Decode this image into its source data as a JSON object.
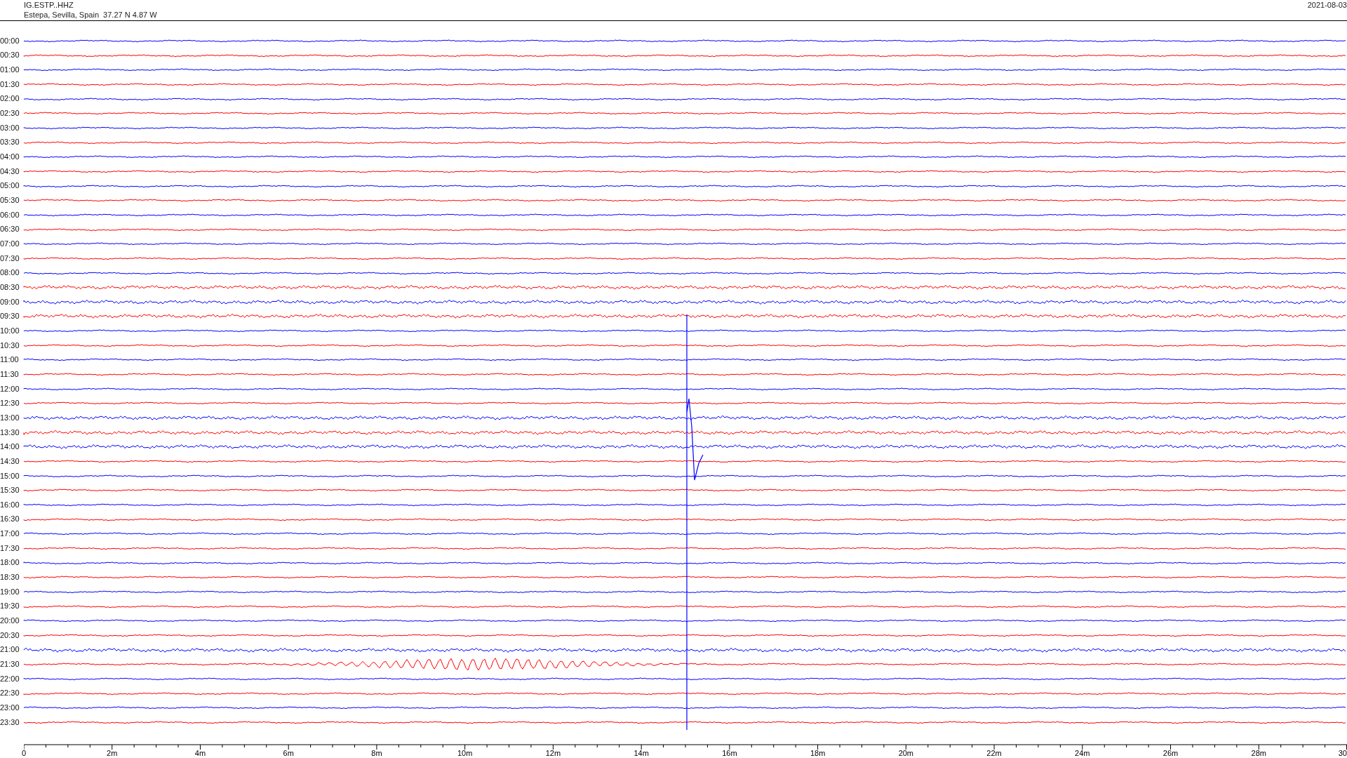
{
  "header": {
    "station": "IG.ESTP..HHZ",
    "location": "Estepa, Sevilla, Spain  37.27 N 4.87 W",
    "date": "2021-08-03"
  },
  "traces": [
    {
      "time": "00:00",
      "color": "#0000ff"
    },
    {
      "time": "00:30",
      "color": "#ff0000"
    },
    {
      "time": "01:00",
      "color": "#0000ff"
    },
    {
      "time": "01:30",
      "color": "#ff0000"
    },
    {
      "time": "02:00",
      "color": "#0000ff"
    },
    {
      "time": "02:30",
      "color": "#ff0000"
    },
    {
      "time": "03:00",
      "color": "#0000ff"
    },
    {
      "time": "03:30",
      "color": "#ff0000"
    },
    {
      "time": "04:00",
      "color": "#0000ff"
    },
    {
      "time": "04:30",
      "color": "#ff0000"
    },
    {
      "time": "05:00",
      "color": "#0000ff"
    },
    {
      "time": "05:30",
      "color": "#ff0000"
    },
    {
      "time": "06:00",
      "color": "#0000ff"
    },
    {
      "time": "06:30",
      "color": "#ff0000"
    },
    {
      "time": "07:00",
      "color": "#0000ff"
    },
    {
      "time": "07:30",
      "color": "#ff0000"
    },
    {
      "time": "08:00",
      "color": "#0000ff"
    },
    {
      "time": "08:30",
      "color": "#ff0000"
    },
    {
      "time": "09:00",
      "color": "#0000ff"
    },
    {
      "time": "09:30",
      "color": "#ff0000"
    },
    {
      "time": "10:00",
      "color": "#0000ff"
    },
    {
      "time": "10:30",
      "color": "#ff0000"
    },
    {
      "time": "11:00",
      "color": "#0000ff"
    },
    {
      "time": "11:30",
      "color": "#ff0000"
    },
    {
      "time": "12:00",
      "color": "#0000ff"
    },
    {
      "time": "12:30",
      "color": "#ff0000"
    },
    {
      "time": "13:00",
      "color": "#0000ff"
    },
    {
      "time": "13:30",
      "color": "#ff0000"
    },
    {
      "time": "14:00",
      "color": "#0000ff"
    },
    {
      "time": "14:30",
      "color": "#ff0000"
    },
    {
      "time": "15:00",
      "color": "#0000ff"
    },
    {
      "time": "15:30",
      "color": "#ff0000"
    },
    {
      "time": "16:00",
      "color": "#0000ff"
    },
    {
      "time": "16:30",
      "color": "#ff0000"
    },
    {
      "time": "17:00",
      "color": "#0000ff"
    },
    {
      "time": "17:30",
      "color": "#ff0000"
    },
    {
      "time": "18:00",
      "color": "#0000ff"
    },
    {
      "time": "18:30",
      "color": "#ff0000"
    },
    {
      "time": "19:00",
      "color": "#0000ff"
    },
    {
      "time": "19:30",
      "color": "#ff0000"
    },
    {
      "time": "20:00",
      "color": "#0000ff"
    },
    {
      "time": "20:30",
      "color": "#ff0000"
    },
    {
      "time": "21:00",
      "color": "#0000ff"
    },
    {
      "time": "21:30",
      "color": "#ff0000"
    },
    {
      "time": "22:00",
      "color": "#0000ff"
    },
    {
      "time": "22:30",
      "color": "#ff0000"
    },
    {
      "time": "23:00",
      "color": "#0000ff"
    },
    {
      "time": "23:30",
      "color": "#ff0000"
    }
  ],
  "axis": {
    "labels": [
      "0",
      "2m",
      "4m",
      "6m",
      "8m",
      "10m",
      "12m",
      "14m",
      "16m",
      "18m",
      "20m",
      "22m",
      "24m",
      "26m",
      "28m",
      "30"
    ]
  }
}
